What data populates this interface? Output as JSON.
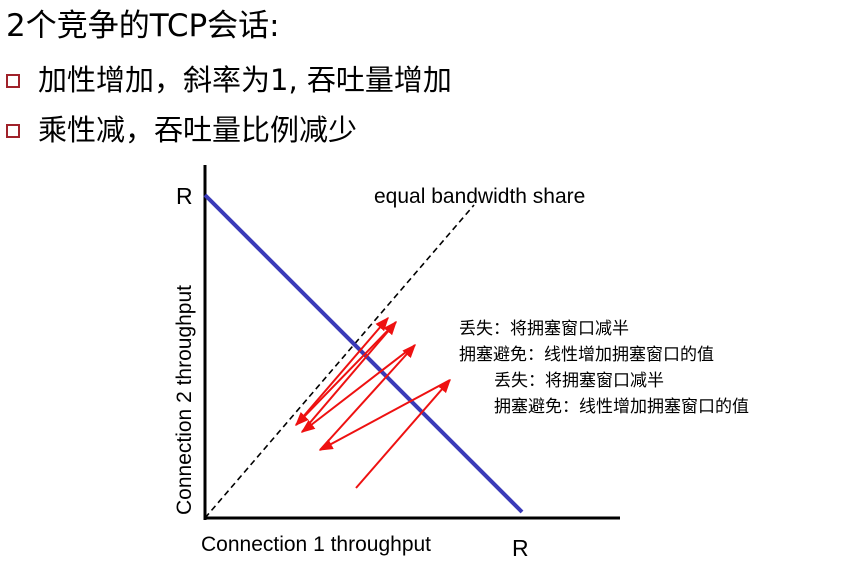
{
  "title": "2个竞争的TCP会话:",
  "bullets": [
    "加性增加，斜率为1, 吞吐量增加",
    "乘性减，吞吐量比例减少"
  ],
  "diagram": {
    "r_label_y": "R",
    "r_label_x": "R",
    "y_axis_label": "Connection 2 throughput",
    "x_axis_label": "Connection 1 throughput",
    "diagonal_label": "equal bandwidth share",
    "annotations": [
      "丢失：将拥塞窗口减半",
      "拥塞避免：线性增加拥塞窗口的值",
      "丢失：将拥塞窗口减半",
      "拥塞避免：线性增加拥塞窗口的值"
    ],
    "colors": {
      "capacity_line": "#3a3ab8",
      "trajectory": "#ee1111",
      "bullet": "#a0222a",
      "axes": "#000000"
    }
  }
}
